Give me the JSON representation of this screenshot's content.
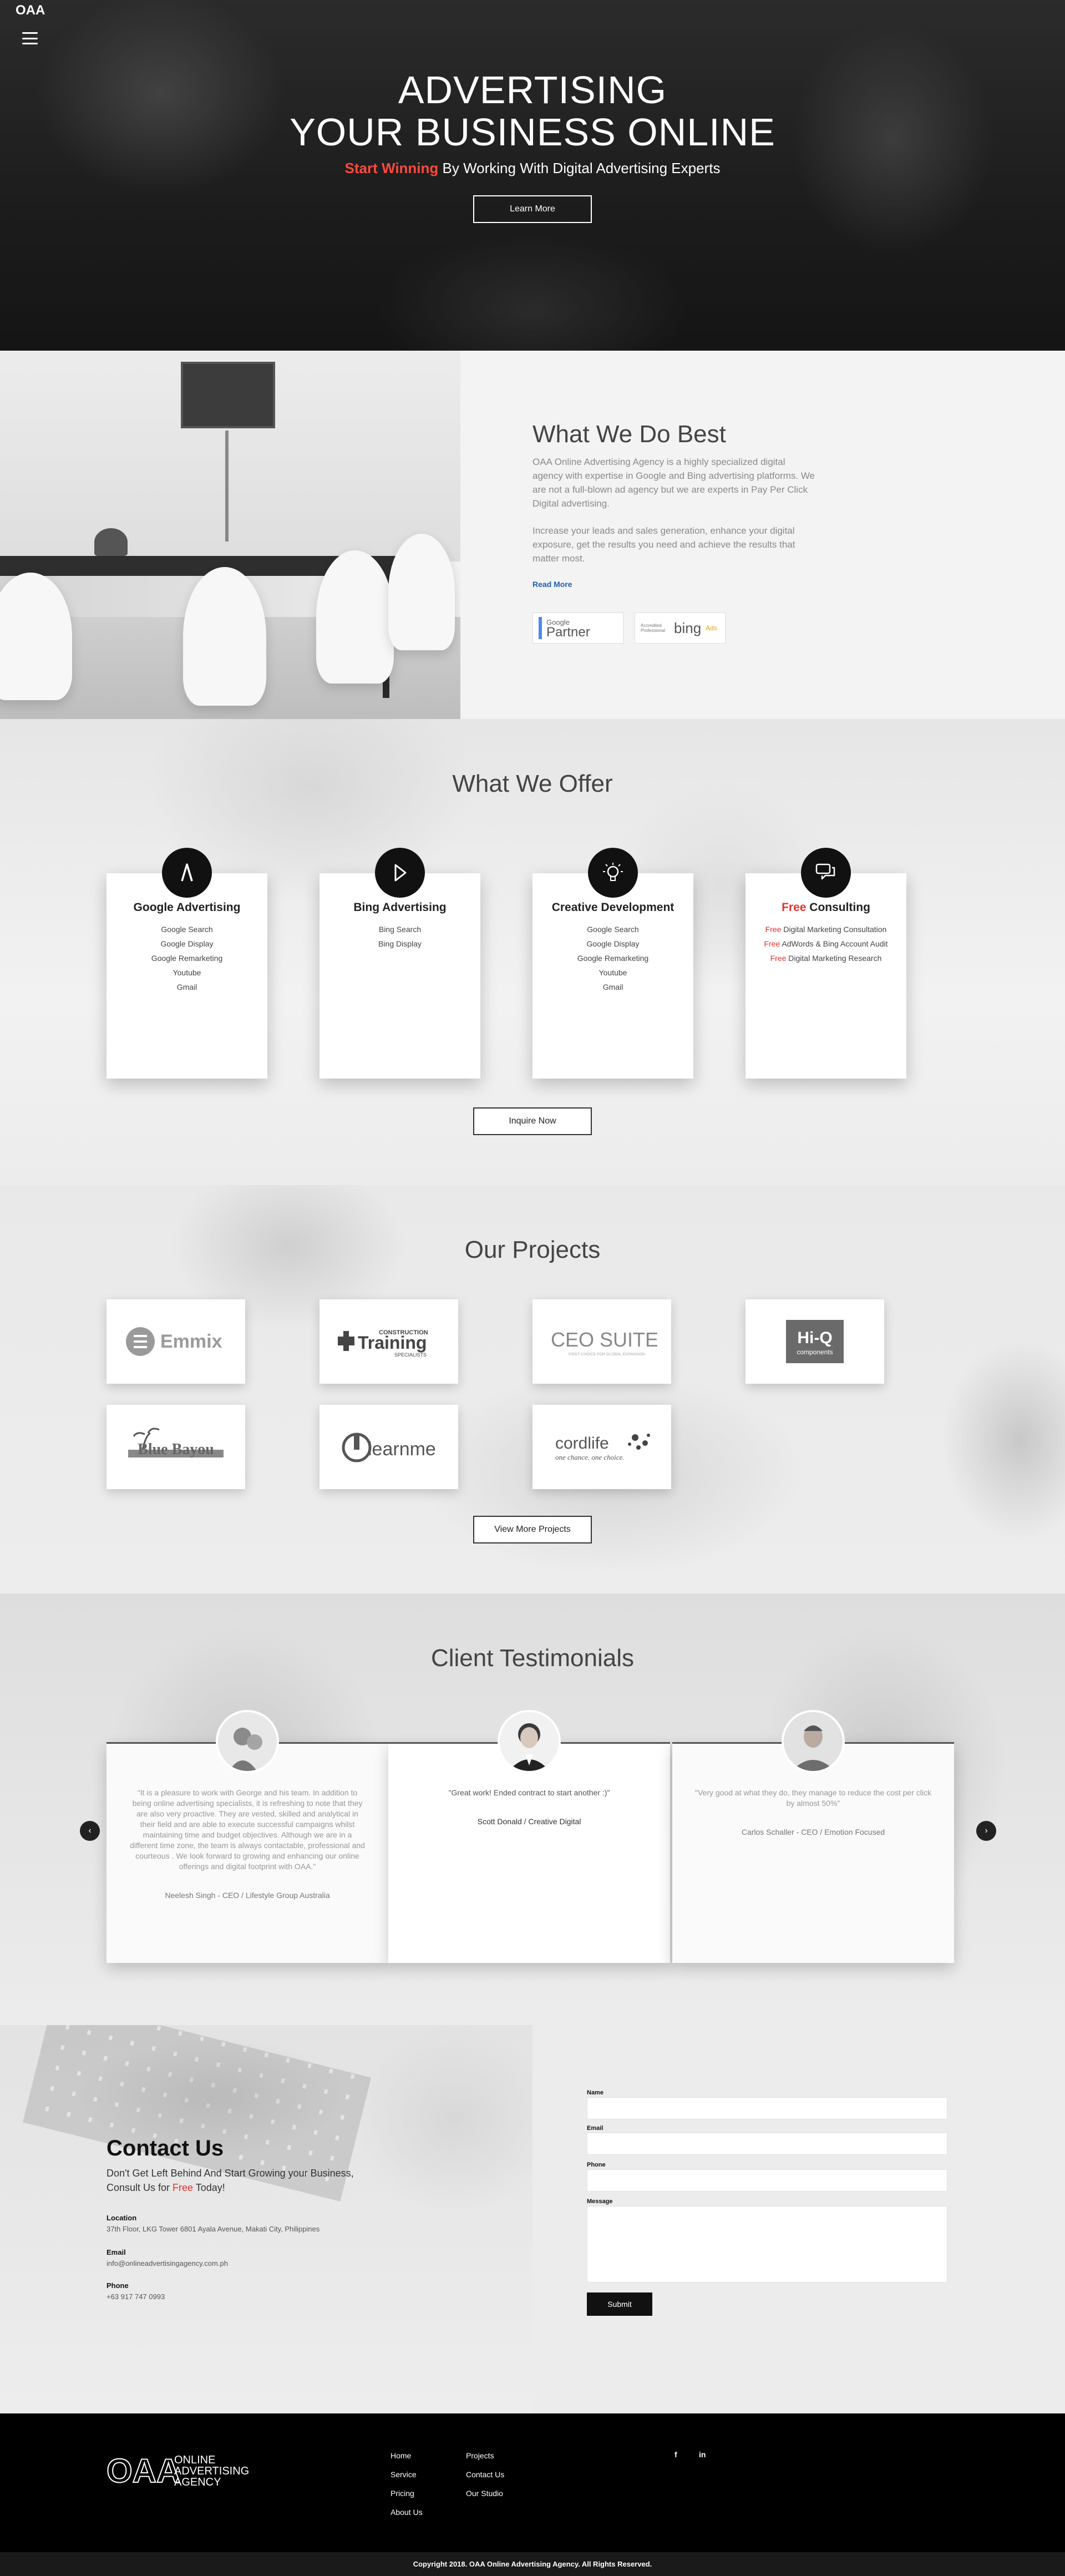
{
  "brand": {
    "logo_text": "OAA",
    "footer_lines": [
      "ONLINE",
      "ADVERTISING",
      "AGENCY"
    ]
  },
  "hero": {
    "title_line1": "ADVERTISING",
    "title_line2": "YOUR BUSINESS ONLINE",
    "sub_accent": "Start Winning",
    "sub_rest": " By Working With Digital Advertising Experts",
    "button": "Learn More"
  },
  "best": {
    "title": "What We Do Best",
    "para1": "OAA Online Advertising Agency is a highly specialized digital agency with expertise in Google and Bing advertising platforms. We are not a full-blown ad agency but we are experts in Pay Per Click Digital advertising.",
    "para2": "Increase your leads and sales generation, enhance your digital exposure, get the results you need and achieve the results that matter most.",
    "read_more": "Read More",
    "google_badge": {
      "top": "Google",
      "bottom": "Partner"
    },
    "bing_badge": {
      "small": "Accredited Professional",
      "word": "bing",
      "ads": "Ads"
    }
  },
  "offer": {
    "title": "What We Offer",
    "cards": [
      {
        "title": "Google Advertising",
        "items": [
          "Google Search",
          "Google Display",
          "Google Remarketing",
          "Youtube",
          "Gmail"
        ]
      },
      {
        "title": "Bing Advertising",
        "items": [
          "Bing Search",
          "Bing Display"
        ]
      },
      {
        "title": "Creative Development",
        "items": [
          "Google Search",
          "Google Display",
          "Google Remarketing",
          "Youtube",
          "Gmail"
        ]
      },
      {
        "title_accent": "Free",
        "title_rest": " Consulting",
        "items": [
          {
            "accent": "Free",
            "rest": " Digital Marketing Consultation"
          },
          {
            "accent": "Free",
            "rest": " AdWords & Bing Account Audit"
          },
          {
            "accent": "Free",
            "rest": " Digital Marketing Research"
          }
        ]
      }
    ],
    "button": "Inquire Now"
  },
  "projects": {
    "title": "Our Projects",
    "logos": [
      "Emmix",
      "Construction Training",
      "CEO SUITE",
      "Hi-Q components",
      "Blue Bayou",
      "learnme",
      "cordlife"
    ],
    "logo_texts": {
      "emmix": "Emmix",
      "construction_top": "CONSTRUCTION",
      "construction_main": "Training",
      "construction_sub": "SPECIALISTS",
      "ceo": "CEO SUITE",
      "ceo_sub": "FIRST CHOICE FOR GLOBAL EXPANSION",
      "hiq_main": "Hi-Q",
      "hiq_sub": "components",
      "bayou": "Blue Bayou",
      "learnme": "learnme",
      "cordlife_main": "cordlife",
      "cordlife_sub": "one chance. one choice."
    },
    "button": "View More Projects"
  },
  "testimonials": {
    "title": "Client Testimonials",
    "items": [
      {
        "quote": "\"It is a pleasure to work with George and his team. In addition to being online advertising specialists, it is refreshing to note that they are also very proactive. They are vested, skilled and analytical in their field and are able to execute successful campaigns whilst maintaining time and budget objectives. Although we are in a different time zone, the team is always contactable, professional and courteous . We look forward to growing and enhancing our online offerings and digital footprint with OAA.\"",
        "author": "Neelesh Singh - CEO / Lifestyle Group Australia"
      },
      {
        "quote": "\"Great work! Ended contract to start another :)\"",
        "author": "Scott Donald / Creative Digital"
      },
      {
        "quote": "\"Very good at what they do, they manage to reduce the cost per click by almost 50%\"",
        "author": "Carlos Schaller - CEO / Emotion Focused"
      }
    ],
    "prev": "‹",
    "next": "›"
  },
  "contact": {
    "title": "Contact Us",
    "lead_before": "Don't Get Left Behind And Start Growing your Business, Consult Us for ",
    "lead_accent": "Free",
    "lead_after": " Today!",
    "location_label": "Location",
    "location": "37th Floor, LKG Tower 6801 Ayala Avenue, Makati City, Philippines",
    "email_label": "Email",
    "email": "info@onlineadvertisingagency.com.ph",
    "phone_label": "Phone",
    "phone": "+63 917 747 0993",
    "form": {
      "name_label": "Name",
      "email_label": "Email",
      "phone_label": "Phone",
      "message_label": "Message",
      "submit": "Submit"
    }
  },
  "footer": {
    "col1": [
      "Home",
      "Service",
      "Pricing",
      "About Us"
    ],
    "col2": [
      "Projects",
      "Contact Us",
      "Our Studio"
    ],
    "social": [
      "f",
      "in"
    ],
    "copyright": "Copyright 2018. OAA Online Advertising Agency. All Rights Reserved."
  },
  "colors": {
    "accent_red": "#e3322b",
    "hero_red": "#ff4a3d",
    "link_blue": "#1f5fb0",
    "dark": "#111111"
  },
  "icons": [
    "menu-icon",
    "google-ads-icon",
    "bing-icon",
    "lightbulb-icon",
    "chat-bubbles-icon",
    "chevron-left-icon",
    "chevron-right-icon",
    "facebook-icon",
    "linkedin-icon"
  ]
}
